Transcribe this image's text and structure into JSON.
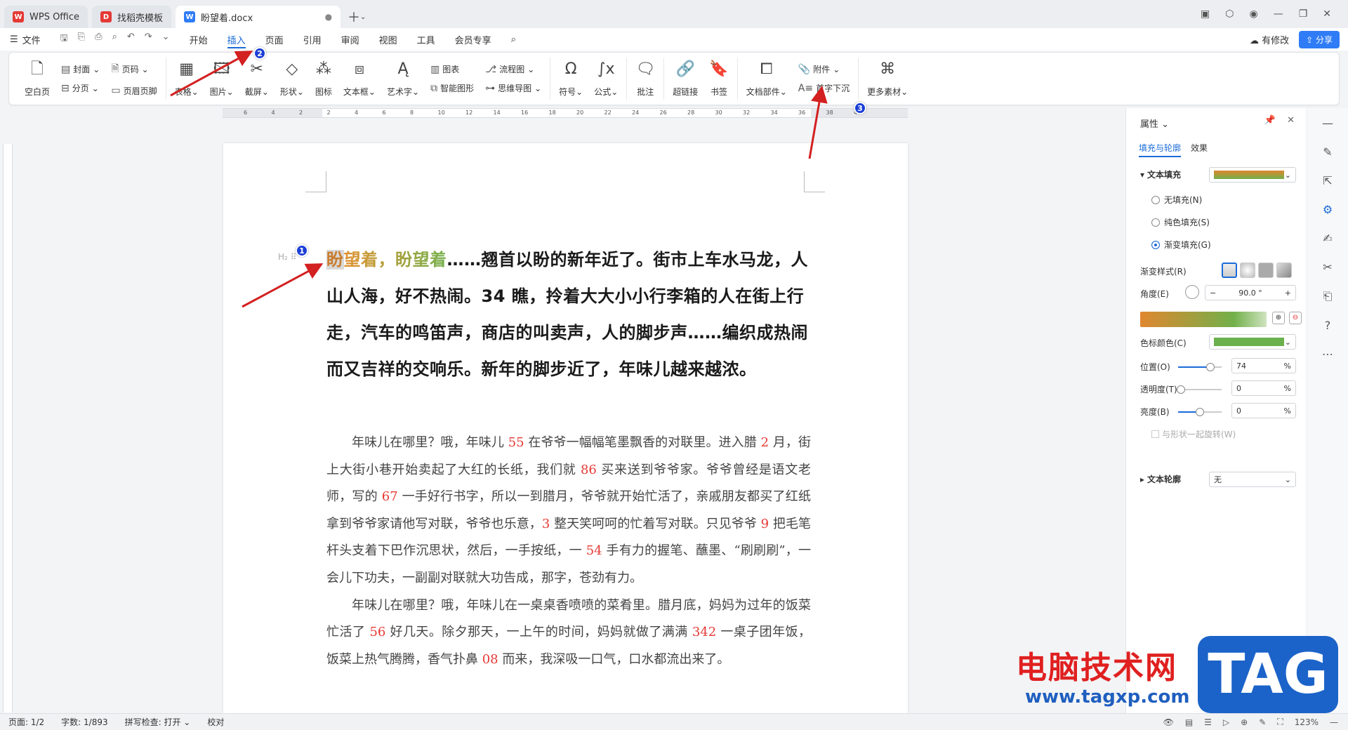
{
  "tabs": [
    {
      "label": "WPS Office",
      "logo_color": "#e53935"
    },
    {
      "label": "找稻壳模板",
      "logo_color": "#e53935"
    },
    {
      "label": "盼望着.docx",
      "logo_color": "#2f7cf6"
    }
  ],
  "menu": {
    "file": "文件",
    "tabs": [
      "开始",
      "插入",
      "页面",
      "引用",
      "审阅",
      "视图",
      "工具",
      "会员专享"
    ],
    "active_tab": "插入",
    "has_changes": "有修改",
    "share": "分享"
  },
  "ribbon": {
    "blank_page": "空白页",
    "cover": "封面",
    "page_break": "分页",
    "page_number": "页码",
    "header_footer": "页眉页脚",
    "table": "表格",
    "picture": "图片",
    "screenshot": "截屏",
    "shape": "形状",
    "icon": "图标",
    "textbox": "文本框",
    "wordart": "艺术字",
    "chart": "图表",
    "smart_shape": "智能图形",
    "flowchart": "流程图",
    "mindmap": "思维导图",
    "symbol": "符号",
    "formula": "公式",
    "comment": "批注",
    "hyperlink": "超链接",
    "bookmark": "书签",
    "attachment": "附件",
    "doc_parts": "文档部件",
    "drop_cap": "首字下沉",
    "more_materials": "更多素材"
  },
  "ruler": {
    "numbers": [
      "6",
      "4",
      "2",
      "2",
      "4",
      "6",
      "8",
      "10",
      "12",
      "14",
      "16",
      "18",
      "20",
      "22",
      "24",
      "26",
      "28",
      "30",
      "32",
      "34",
      "36",
      "38",
      "40"
    ]
  },
  "document": {
    "heading_highlight": "盼",
    "heading_gradient": "望着，盼望着",
    "heading_rest": "……翘首以盼的新年近了。街市上车水马龙，人山人海，好不热闹。34 瞧，拎着大大小小行李箱的人在街上行走，汽车的鸣笛声，商店的叫卖声，人的脚步声……编织成热闹而又吉祥的交响乐。新年的脚步近了，年味儿越来越浓。",
    "heading_mark": "H₂",
    "p1": [
      {
        "t": "年味儿在哪里？哦，年味儿 "
      },
      {
        "n": "55"
      },
      {
        "t": " 在爷爷一幅幅笔墨飘香的对联里。进入腊 "
      },
      {
        "n": "2"
      },
      {
        "t": " 月，街上大街小巷开始卖起了大红的长纸，我们就 "
      },
      {
        "n": "86"
      },
      {
        "t": " 买来送到爷爷家。爷爷曾经是语文老师，写的 "
      },
      {
        "n": "67"
      },
      {
        "t": " 一手好行书字，所以一到腊月，爷爷就开始忙活了，亲戚朋友都买了红纸拿到爷爷家请他写对联，爷爷也乐意，"
      },
      {
        "n": "3"
      },
      {
        "t": " 整天笑呵呵的忙着写对联。只见爷爷 "
      },
      {
        "n": "9"
      },
      {
        "t": " 把毛笔杆头支着下巴作沉思状，然后，一手按纸，一 "
      },
      {
        "n": "54"
      },
      {
        "t": " 手有力的握笔、蘸墨、“刷刷刷”，一会儿下功夫，一副副对联就大功告成，那字，苍劲有力。"
      }
    ],
    "p2": [
      {
        "t": "年味儿在哪里？哦，年味儿在一桌桌香喷喷的菜肴里。腊月底，妈妈为过年的饭菜忙活了 "
      },
      {
        "n": "56"
      },
      {
        "t": " 好几天。除夕那天，一上午的时间，妈妈就做了满满 "
      },
      {
        "n": "342"
      },
      {
        "t": " 一桌子团年饭，饭菜上热气腾腾，香气扑鼻 "
      },
      {
        "n": "08"
      },
      {
        "t": " 而来，我深吸一口气，口水都流出来了。"
      }
    ]
  },
  "panel": {
    "title": "属性",
    "tab_fill": "填充与轮廓",
    "tab_effect": "效果",
    "text_fill": "文本填充",
    "no_fill": "无填充(N)",
    "solid_fill": "纯色填充(S)",
    "gradient_fill": "渐变填充(G)",
    "gradient_style": "渐变样式(R)",
    "angle_label": "角度(E)",
    "angle_value": "90.0 °",
    "stop_color": "色标颜色(C)",
    "position_label": "位置(O)",
    "position_value": "74",
    "position_fraction": 0.74,
    "transparency_label": "透明度(T)",
    "transparency_value": "0",
    "brightness_label": "亮度(B)",
    "brightness_value": "0",
    "percent": "%",
    "rotate_with_shape": "与形状一起旋转(W)",
    "text_outline": "文本轮廓",
    "outline_value": "无",
    "gradient_start": "#e0872f",
    "gradient_end": "#72b04a",
    "stop_color_hex": "#6ab04c"
  },
  "status": {
    "page": "页面: 1/2",
    "words": "字数: 1/893",
    "spell": "拼写检查: 打开",
    "proof": "校对",
    "zoom": "123%"
  },
  "badges": [
    "1",
    "2",
    "3"
  ],
  "watermark": {
    "text": "电脑技术网",
    "url": "www.tagxp.com",
    "tag": "TAG"
  }
}
